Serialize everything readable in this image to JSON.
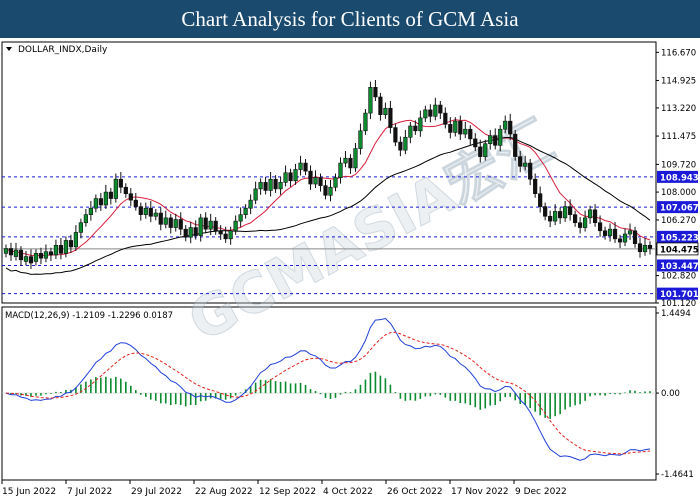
{
  "header": {
    "title": "Chart Analysis for Clients of GCM Asia"
  },
  "watermark": {
    "text": "GCMASIA宏汇"
  },
  "chart_data": [
    {
      "type": "candlestick",
      "symbol_label": "DOLLAR_INDX,Daily",
      "ylim": [
        101.12,
        117.31
      ],
      "y_ticks": [
        "116.670",
        "114.925",
        "113.220",
        "111.475",
        "109.720",
        "108.000",
        "106.270",
        "104.475",
        "102.820",
        "101.120"
      ],
      "x_ticks": [
        "15 Jun 2022",
        "7 Jul 2022",
        "29 Jul 2022",
        "22 Aug 2022",
        "12 Sep 2022",
        "4 Oct 2022",
        "26 Oct 2022",
        "17 Nov 2022",
        "9 Dec 2022"
      ],
      "current_price": {
        "value": 104.475,
        "label": "104.475"
      },
      "levels": [
        {
          "value": 108.943,
          "label": "108.943"
        },
        {
          "value": 107.067,
          "label": "107.067"
        },
        {
          "value": 105.223,
          "label": "105.223"
        },
        {
          "value": 103.447,
          "label": "103.447"
        },
        {
          "value": 101.701,
          "label": "101.701"
        }
      ],
      "ma_fast_color": "#d81e3c",
      "ma_slow_color": "#000000",
      "up_color": "#0b8a2e",
      "down_color": "#111111",
      "closes": [
        104.5,
        104.1,
        104.4,
        103.8,
        104.0,
        103.6,
        104.2,
        103.9,
        104.3,
        104.1,
        104.7,
        104.2,
        105.0,
        104.6,
        105.5,
        106.1,
        106.6,
        107.0,
        107.6,
        107.2,
        108.0,
        107.6,
        108.8,
        108.3,
        107.9,
        107.5,
        107.1,
        106.6,
        107.0,
        106.5,
        106.7,
        106.0,
        106.4,
        105.8,
        106.3,
        105.7,
        105.2,
        105.8,
        105.3,
        106.4,
        105.7,
        106.2,
        105.6,
        105.4,
        105.1,
        105.6,
        106.2,
        106.6,
        107.0,
        107.5,
        108.2,
        108.6,
        108.1,
        108.8,
        108.2,
        108.6,
        109.2,
        108.7,
        109.4,
        109.8,
        109.3,
        108.5,
        108.9,
        108.4,
        107.8,
        108.3,
        108.9,
        109.8,
        110.1,
        109.5,
        110.7,
        111.8,
        112.9,
        114.5,
        113.9,
        112.8,
        113.2,
        112.0,
        111.1,
        110.6,
        111.4,
        112.1,
        111.8,
        112.6,
        113.1,
        112.7,
        113.4,
        112.9,
        112.2,
        111.7,
        112.4,
        111.6,
        111.9,
        111.3,
        110.8,
        110.2,
        111.0,
        111.5,
        110.9,
        111.9,
        112.4,
        111.6,
        110.2,
        109.6,
        109.8,
        108.8,
        107.9,
        107.1,
        106.5,
        106.2,
        106.8,
        106.4,
        107.1,
        106.6,
        106.1,
        105.8,
        106.4,
        106.9,
        106.1,
        105.6,
        105.3,
        105.7,
        105.1,
        104.9,
        105.4,
        105.6,
        104.8,
        104.3,
        104.7,
        104.5
      ],
      "opens": [
        104.2,
        104.5,
        104.0,
        104.4,
        103.7,
        104.0,
        103.7,
        104.2,
        103.9,
        104.3,
        104.1,
        104.7,
        104.2,
        105.0,
        104.6,
        105.5,
        106.1,
        106.6,
        107.0,
        107.6,
        107.2,
        108.0,
        107.6,
        108.8,
        108.3,
        107.9,
        107.5,
        107.1,
        106.6,
        107.0,
        106.5,
        106.7,
        106.0,
        106.4,
        105.8,
        106.3,
        105.7,
        105.2,
        105.8,
        105.3,
        106.4,
        105.7,
        106.2,
        105.6,
        105.4,
        105.1,
        105.6,
        106.2,
        106.6,
        107.0,
        107.5,
        108.2,
        108.6,
        108.1,
        108.8,
        108.2,
        108.6,
        109.2,
        108.7,
        109.4,
        109.8,
        109.3,
        108.5,
        108.9,
        108.4,
        107.8,
        108.3,
        108.9,
        109.8,
        110.1,
        109.5,
        110.7,
        111.8,
        112.9,
        114.5,
        113.9,
        112.8,
        113.2,
        112.0,
        111.1,
        110.6,
        111.4,
        112.1,
        111.8,
        112.6,
        113.1,
        112.7,
        113.4,
        112.9,
        112.2,
        111.7,
        112.4,
        111.6,
        111.9,
        111.3,
        110.8,
        110.2,
        111.0,
        111.5,
        110.9,
        111.9,
        112.4,
        111.6,
        110.2,
        109.6,
        109.8,
        108.8,
        107.9,
        107.1,
        106.5,
        106.2,
        106.8,
        106.4,
        107.1,
        106.6,
        106.1,
        105.8,
        106.4,
        106.9,
        106.1,
        105.6,
        105.3,
        105.7,
        105.1,
        104.9,
        105.4,
        105.6,
        104.8,
        104.3,
        104.7
      ]
    },
    {
      "type": "macd",
      "label": "MACD(12,26,9) -1.2109 -1.2296 0.0187",
      "ylim": [
        -1.4641,
        1.4494
      ],
      "y_ticks": [
        "1.4494",
        "0.00",
        "-1.4641"
      ],
      "macd_color": "#1f3fd8",
      "signal_color": "#e0231d",
      "hist_color": "#0b8a2e"
    }
  ]
}
